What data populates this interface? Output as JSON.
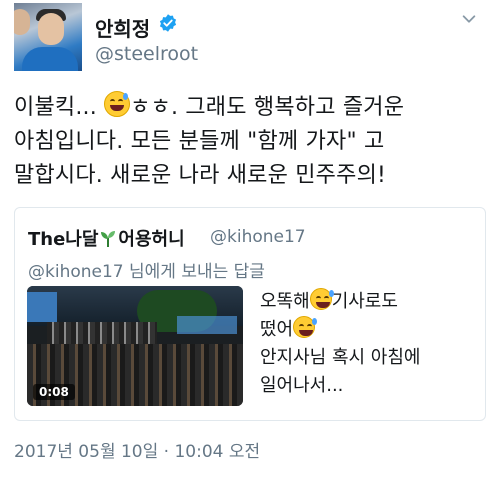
{
  "author": {
    "display_name": "안희정",
    "handle": "@steelroot",
    "verified": true,
    "avatar_icon": "profile-photo"
  },
  "tweet": {
    "lines": [
      {
        "before": "이불킥... ",
        "after": "ㅎㅎ. 그래도 행복하고 즐거운"
      },
      {
        "text": "아침입니다.  모든 분들께 \"함께 가자\" 고"
      },
      {
        "text": "말합시다. 새로운 나라 새로운 민주주의!"
      }
    ]
  },
  "quoted": {
    "name_prefix": "The나달",
    "name_suffix": "어용허니",
    "handle": "@kihone17",
    "reply_handle": "@kihone17",
    "reply_text": " 님에게 보내는 답글",
    "text_line1_before": "오똑해",
    "text_line1_after": "기사로도",
    "text_line2_before": "떴어",
    "text_line3": "안지사님 혹시 아침에",
    "text_line4": "일어나서...",
    "media_duration": "0:08"
  },
  "footer": {
    "date": "2017년 05월 10일",
    "separator": " · ",
    "time": "10:04 오전"
  },
  "colors": {
    "text": "#14171a",
    "secondary": "#657786",
    "verified_blue": "#1da1f2",
    "border": "#e1e8ed"
  },
  "icons": [
    "verified-badge-icon",
    "chevron-down-icon",
    "grinning-sweat-emoji",
    "sprout-emoji",
    "video-duration-badge"
  ]
}
